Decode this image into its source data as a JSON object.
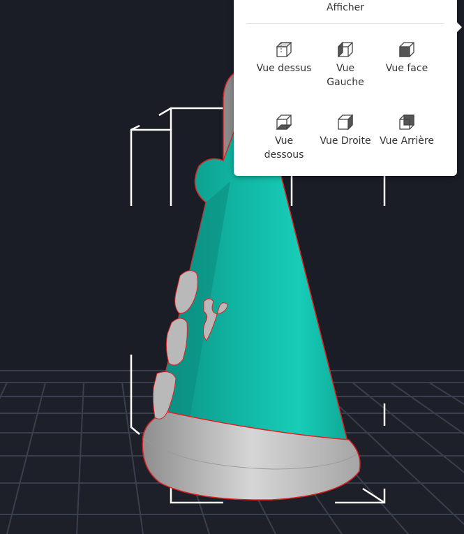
{
  "popup": {
    "title": "Afficher",
    "views": [
      {
        "id": "top",
        "label": "Vue dessus",
        "icon": "cube-top-icon"
      },
      {
        "id": "left",
        "label": "Vue Gauche",
        "icon": "cube-left-icon"
      },
      {
        "id": "front",
        "label": "Vue face",
        "icon": "cube-front-icon"
      },
      {
        "id": "bottom",
        "label": "Vue dessous",
        "icon": "cube-bottom-icon"
      },
      {
        "id": "right",
        "label": "Vue Droite",
        "icon": "cube-right-icon"
      },
      {
        "id": "back",
        "label": "Vue Arrière",
        "icon": "cube-back-icon"
      }
    ]
  },
  "scene": {
    "model_color": "#10b3a2",
    "base_color": "#c2c2c2",
    "outline_color": "#e02020",
    "grid_color": "#3a3f4d",
    "background": "#1b1d26"
  }
}
